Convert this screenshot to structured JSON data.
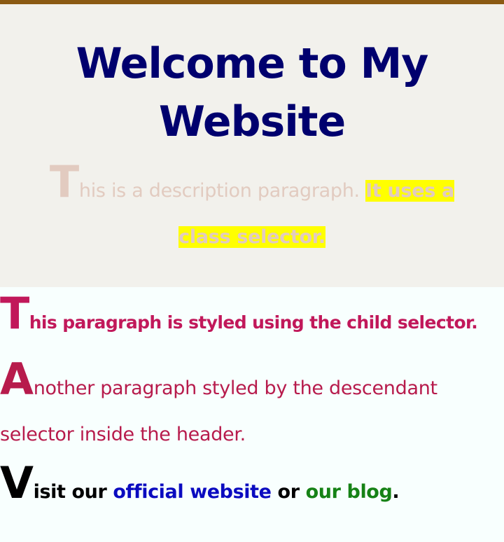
{
  "header": {
    "title": "Welcome to My Website",
    "description": {
      "dropcap": "T",
      "text": "his is a description paragraph. ",
      "highlight": "It uses a class selector."
    }
  },
  "main": {
    "child_paragraph": {
      "dropcap": "T",
      "text": "his paragraph is styled using the child selector."
    },
    "descendant_paragraph": {
      "dropcap": "A",
      "text": "nother paragraph styled by the descendant selector inside the header."
    },
    "visit_paragraph": {
      "dropcap": "V",
      "prefix": "isit our ",
      "link_official": "official website",
      "middle": " or ",
      "link_blog": "our blog",
      "suffix": "."
    }
  },
  "colors": {
    "top_bar": "#8b5a12",
    "header_bg": "#f2f1ec",
    "title": "#00006e",
    "description": "#e2cbc0",
    "highlight_bg": "#ffff00",
    "child_paragraph": "#c1185a",
    "descendant_paragraph": "#b71b4c",
    "link_official": "#0b0bc0",
    "link_blog": "#168216"
  }
}
